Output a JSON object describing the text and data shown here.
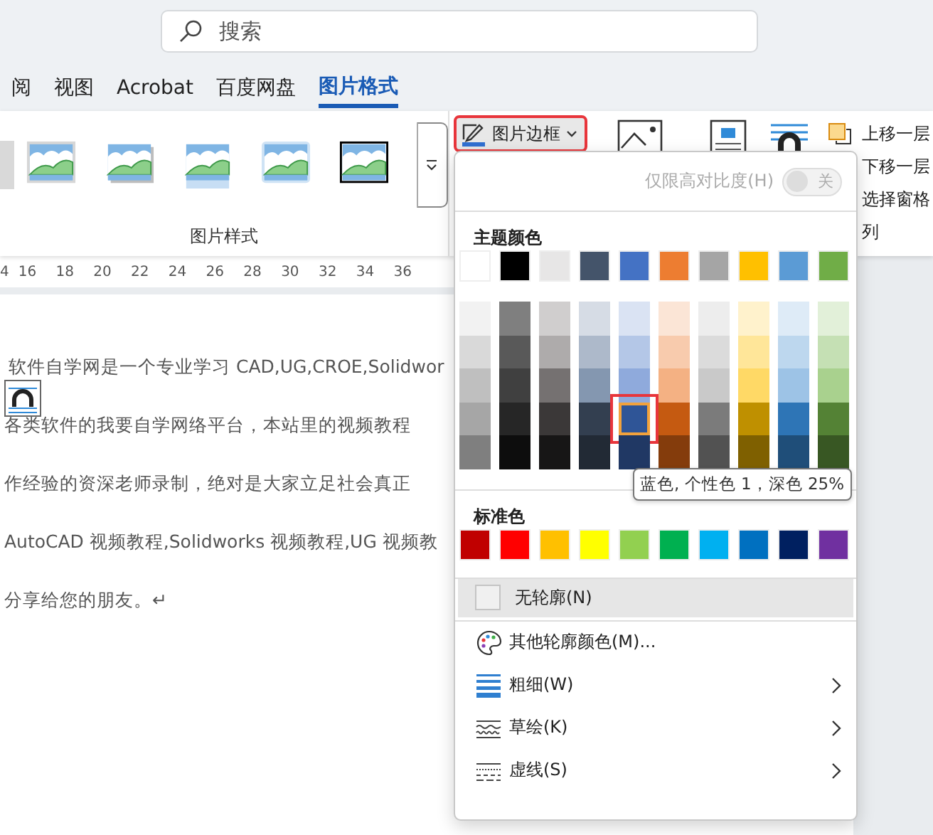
{
  "search": {
    "placeholder": "搜索"
  },
  "tabs": [
    {
      "label": "阅",
      "selected": false
    },
    {
      "label": "视图",
      "selected": false
    },
    {
      "label": "Acrobat",
      "selected": false
    },
    {
      "label": "百度网盘",
      "selected": false
    },
    {
      "label": "图片格式",
      "selected": true
    }
  ],
  "ribbon": {
    "group_label": "图片样式",
    "border_button": {
      "label": "图片边框",
      "outlined": true
    },
    "arrange": [
      "上移一层",
      "下移一层",
      "选择窗格",
      "列"
    ]
  },
  "ruler": [
    "4",
    "16",
    "18",
    "20",
    "22",
    "24",
    "26",
    "28",
    "30",
    "32",
    "34",
    "36"
  ],
  "document": {
    "lines": [
      "软件自学网是一个专业学习 CAD,UG,CROE,Solidwor",
      "各类软件的我要自学网络平台，本站里的视频教程",
      "作经验的资深老师录制，绝对是大家立足社会真正",
      "AutoCAD 视频教程,Solidworks 视频教程,UG 视频教",
      "分享给您的朋友。↵"
    ]
  },
  "menu": {
    "high_contrast": {
      "label": "仅限高对比度(H)",
      "switch_label": "关",
      "on": false,
      "disabled": true
    },
    "theme_heading": "主题颜色",
    "theme_colors": [
      {
        "color": "#ffffff",
        "selected": false
      },
      {
        "color": "#000000",
        "selected": false
      },
      {
        "color": "#e7e6e6",
        "selected": false
      },
      {
        "color": "#44546a",
        "selected": false
      },
      {
        "color": "#4472c4",
        "selected": false
      },
      {
        "color": "#ed7d31",
        "selected": false
      },
      {
        "color": "#a5a5a5",
        "selected": false
      },
      {
        "color": "#ffc000",
        "selected": false
      },
      {
        "color": "#5b9bd5",
        "selected": false
      },
      {
        "color": "#70ad47",
        "selected": false
      }
    ],
    "theme_shades": [
      {
        "shades": [
          {
            "color": "#f2f2f2",
            "selected": false
          },
          {
            "color": "#d9d9d9",
            "selected": false
          },
          {
            "color": "#bfbfbf",
            "selected": false
          },
          {
            "color": "#a6a6a6",
            "selected": false
          },
          {
            "color": "#7f7f7f",
            "selected": false
          }
        ]
      },
      {
        "shades": [
          {
            "color": "#7f7f7f",
            "selected": false
          },
          {
            "color": "#595959",
            "selected": false
          },
          {
            "color": "#404040",
            "selected": false
          },
          {
            "color": "#262626",
            "selected": false
          },
          {
            "color": "#0d0d0d",
            "selected": false
          }
        ]
      },
      {
        "shades": [
          {
            "color": "#d0cece",
            "selected": false
          },
          {
            "color": "#aeabab",
            "selected": false
          },
          {
            "color": "#757171",
            "selected": false
          },
          {
            "color": "#3b3838",
            "selected": false
          },
          {
            "color": "#171616",
            "selected": false
          }
        ]
      },
      {
        "shades": [
          {
            "color": "#d6dce5",
            "selected": false
          },
          {
            "color": "#adb9ca",
            "selected": false
          },
          {
            "color": "#8497b0",
            "selected": false
          },
          {
            "color": "#333f50",
            "selected": false
          },
          {
            "color": "#222a35",
            "selected": false
          }
        ]
      },
      {
        "shades": [
          {
            "color": "#dae3f3",
            "selected": false
          },
          {
            "color": "#b4c7e7",
            "selected": false
          },
          {
            "color": "#8faadc",
            "selected": false
          },
          {
            "color": "#2f5597",
            "selected": true
          },
          {
            "color": "#203864",
            "selected": false
          }
        ]
      },
      {
        "shades": [
          {
            "color": "#fbe5d6",
            "selected": false
          },
          {
            "color": "#f8cbad",
            "selected": false
          },
          {
            "color": "#f4b183",
            "selected": false
          },
          {
            "color": "#c55a11",
            "selected": false
          },
          {
            "color": "#843c0c",
            "selected": false
          }
        ]
      },
      {
        "shades": [
          {
            "color": "#ededed",
            "selected": false
          },
          {
            "color": "#dbdbdb",
            "selected": false
          },
          {
            "color": "#c9c9c9",
            "selected": false
          },
          {
            "color": "#7b7b7b",
            "selected": false
          },
          {
            "color": "#525252",
            "selected": false
          }
        ]
      },
      {
        "shades": [
          {
            "color": "#fff2cc",
            "selected": false
          },
          {
            "color": "#ffe699",
            "selected": false
          },
          {
            "color": "#ffd966",
            "selected": false
          },
          {
            "color": "#bf9000",
            "selected": false
          },
          {
            "color": "#7f6000",
            "selected": false
          }
        ]
      },
      {
        "shades": [
          {
            "color": "#deebf7",
            "selected": false
          },
          {
            "color": "#bdd7ee",
            "selected": false
          },
          {
            "color": "#9dc3e6",
            "selected": false
          },
          {
            "color": "#2e75b6",
            "selected": false
          },
          {
            "color": "#1f4e79",
            "selected": false
          }
        ]
      },
      {
        "shades": [
          {
            "color": "#e2f0d9",
            "selected": false
          },
          {
            "color": "#c5e0b4",
            "selected": false
          },
          {
            "color": "#a9d18e",
            "selected": false
          },
          {
            "color": "#548235",
            "selected": false
          },
          {
            "color": "#385723",
            "selected": false
          }
        ]
      }
    ],
    "tooltip": "蓝色, 个性色 1，深色 25%",
    "standard_heading": "标准色",
    "standard_colors": [
      {
        "color": "#c00000",
        "selected": false
      },
      {
        "color": "#ff0000",
        "selected": false
      },
      {
        "color": "#ffc000",
        "selected": false
      },
      {
        "color": "#ffff00",
        "selected": false
      },
      {
        "color": "#92d050",
        "selected": false
      },
      {
        "color": "#00b050",
        "selected": false
      },
      {
        "color": "#00b0f0",
        "selected": false
      },
      {
        "color": "#0070c0",
        "selected": false
      },
      {
        "color": "#002060",
        "selected": false
      },
      {
        "color": "#7030a0",
        "selected": false
      }
    ],
    "items": [
      {
        "kind": "no-outline",
        "label": "无轮廓(N)",
        "highlighted": true,
        "submenu": false
      },
      {
        "kind": "more-colors",
        "label": "其他轮廓颜色(M)...",
        "highlighted": false,
        "submenu": false
      },
      {
        "kind": "weight",
        "label": "粗细(W)",
        "highlighted": false,
        "submenu": true
      },
      {
        "kind": "sketch",
        "label": "草绘(K)",
        "highlighted": false,
        "submenu": true
      },
      {
        "kind": "dashes",
        "label": "虚线(S)",
        "highlighted": false,
        "submenu": true
      }
    ]
  }
}
